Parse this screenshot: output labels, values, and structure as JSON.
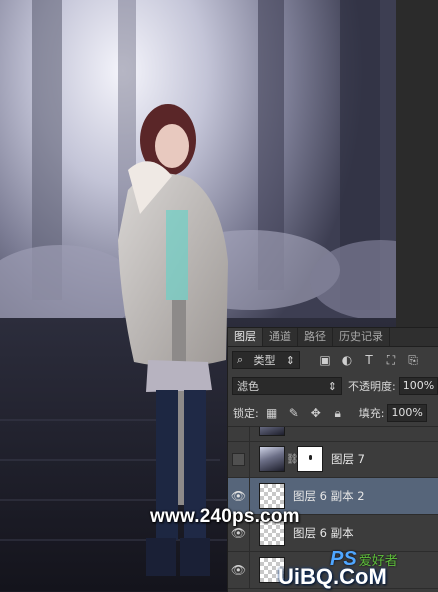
{
  "colors": {
    "panel_bg": "#3c3c3c",
    "selected_layer": "#56657a",
    "wm_blue": "#4fa6ff",
    "wm_green": "#5fbf3c"
  },
  "panel": {
    "tabs": [
      {
        "label": "图层",
        "active": true
      },
      {
        "label": "通道",
        "active": false
      },
      {
        "label": "路径",
        "active": false
      },
      {
        "label": "历史记录",
        "active": false
      }
    ],
    "filter": {
      "search_icon": "⌕",
      "kind_label": "类型",
      "icons": [
        "image-filter-icon",
        "adjustment-filter-icon",
        "type-filter-icon",
        "shape-filter-icon",
        "smart-object-filter-icon"
      ]
    },
    "blend_mode": "滤色",
    "opacity_label": "不透明度:",
    "opacity_value": "100%",
    "lock_label": "锁定:",
    "fill_label": "填充:",
    "fill_value": "100%",
    "layers": [
      {
        "name": "",
        "partial": true,
        "visible": false
      },
      {
        "name": "图层 7",
        "visible": false,
        "has_mask": true
      },
      {
        "name": "图层 6 副本 2",
        "visible": true,
        "selected": true
      },
      {
        "name": "图层 6 副本",
        "visible": true
      },
      {
        "name": "",
        "partial": true,
        "visible": true
      }
    ]
  },
  "watermarks": {
    "site": "www.240ps.com",
    "ps": "PS",
    "ps_cn": "爱好者",
    "uibq": "UiBQ.CoM"
  }
}
